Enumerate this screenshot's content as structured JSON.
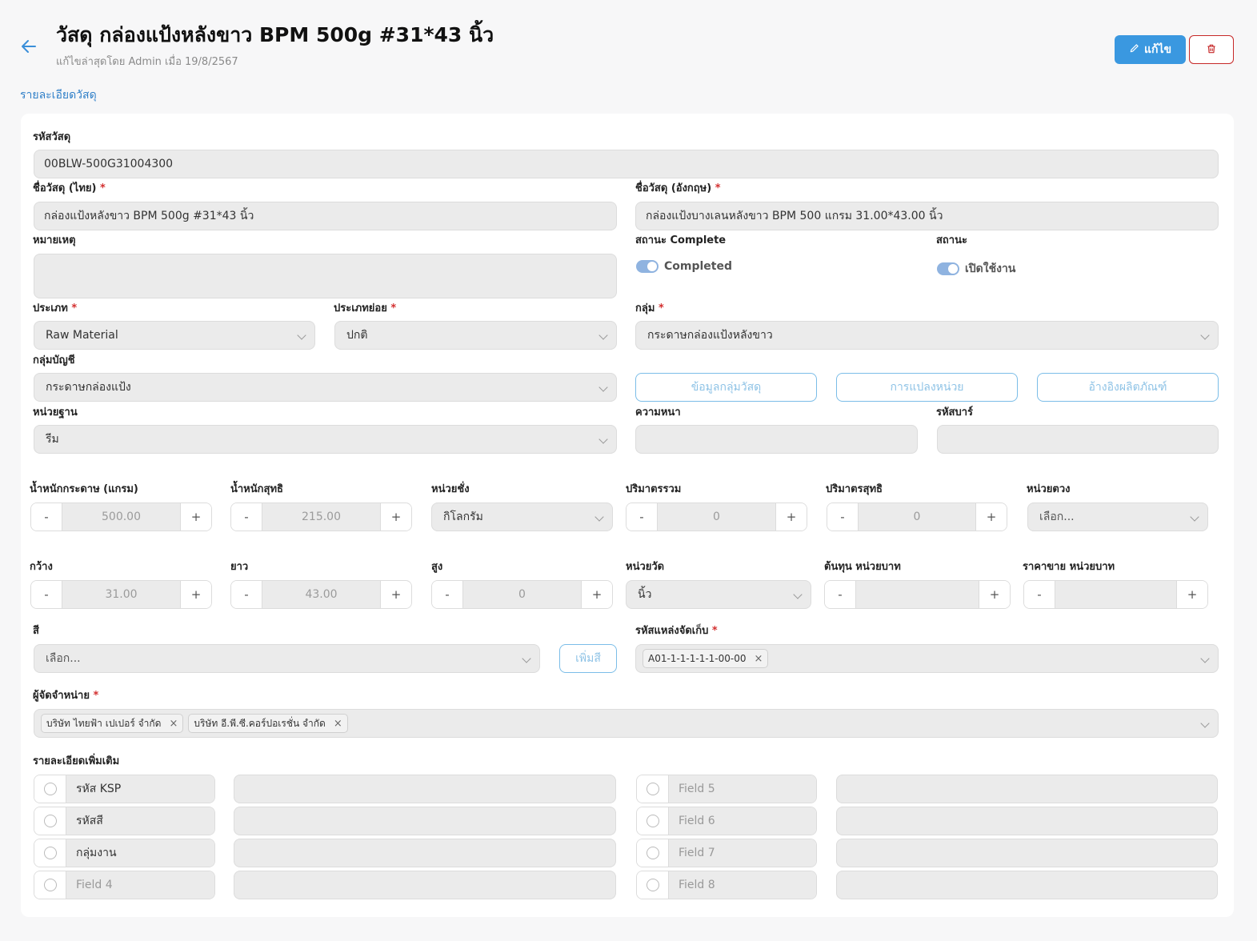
{
  "header": {
    "title": "วัสดุ กล่องแป้งหลังขาว BPM 500g #31*43 นิ้ว",
    "subtitle": "แก้ไขล่าสุดโดย Admin เมื่อ 19/8/2567",
    "edit_label": "แก้ไข",
    "tab_label": "รายละเอียดวัสดุ"
  },
  "form": {
    "code_label": "รหัสวัสดุ",
    "code_value": "00BLW-500G31004300",
    "name_th_label": "ชื่อวัสดุ (ไทย)",
    "name_th_value": "กล่องแป้งหลังขาว BPM 500g #31*43 นิ้ว",
    "name_en_label": "ชื่อวัสดุ (อังกฤษ)",
    "name_en_value": "กล่องแป้งบางเลนหลังขาว BPM 500 แกรม 31.00*43.00 นิ้ว",
    "note_label": "หมายเหตุ",
    "status_complete_label": "สถานะ Complete",
    "status_complete_value": "Completed",
    "status_label": "สถานะ",
    "status_value": "เปิดใช้งาน",
    "type_label": "ประเภท",
    "type_value": "Raw Material",
    "subtype_label": "ประเภทย่อย",
    "subtype_value": "ปกติ",
    "group_label": "กลุ่ม",
    "group_value": "กระดาษกล่องแป้งหลังขาว",
    "account_group_label": "กลุ่มบัญชี",
    "account_group_value": "กระดาษกล่องแป้ง",
    "btn_group_info": "ข้อมูลกลุ่มวัสดุ",
    "btn_unit_convert": "การแปลงหน่วย",
    "btn_product_ref": "อ้างอิงผลิตภัณฑ์",
    "base_unit_label": "หน่วยฐาน",
    "base_unit_value": "รีม",
    "thickness_label": "ความหนา",
    "barcode_label": "รหัสบาร์",
    "paper_weight_label": "น้ำหนักกระดาษ (แกรม)",
    "paper_weight_value": "500.00",
    "net_weight_label": "น้ำหนักสุทธิ",
    "net_weight_value": "215.00",
    "weigh_unit_label": "หน่วยชั่ง",
    "weigh_unit_value": "กิโลกรัม",
    "gross_volume_label": "ปริมาตรรวม",
    "gross_volume_value": "0",
    "net_volume_label": "ปริมาตรสุทธิ",
    "net_volume_value": "0",
    "measure_unit_label": "หน่วยตวง",
    "measure_unit_placeholder": "เลือก...",
    "width_label": "กว้าง",
    "width_value": "31.00",
    "length_label": "ยาว",
    "length_value": "43.00",
    "height_label": "สูง",
    "height_value": "0",
    "dim_unit_label": "หน่วยวัด",
    "dim_unit_value": "นิ้ว",
    "cost_label": "ต้นทุน หน่วยบาท",
    "price_label": "ราคาขาย หน่วยบาท",
    "color_label": "สี",
    "color_placeholder": "เลือก...",
    "add_color_label": "เพิ่มสี",
    "location_label": "รหัสแหล่งจัดเก็บ",
    "location_chips": [
      "A01-1-1-1-1-1-00-00"
    ],
    "supplier_label": "ผู้จัดจำหน่าย",
    "supplier_chips": [
      "บริษัท ไทยฟ้า เปเปอร์ จำกัด",
      "บริษัท อี.พี.ซี.คอร์ปอเรชั่น จำกัด"
    ],
    "extra_label": "รายละเอียดเพิ่มเติม",
    "extra_fields": [
      "รหัส KSP",
      "รหัสสี",
      "กลุ่มงาน",
      "Field 4",
      "Field 5",
      "Field 6",
      "Field 7",
      "Field 8"
    ],
    "required_mark": "*",
    "minus": "-",
    "plus": "+",
    "chip_remove": "×"
  },
  "colors": {
    "accent": "#3a98e0",
    "danger": "#c62828",
    "link": "#2f7fc8"
  }
}
